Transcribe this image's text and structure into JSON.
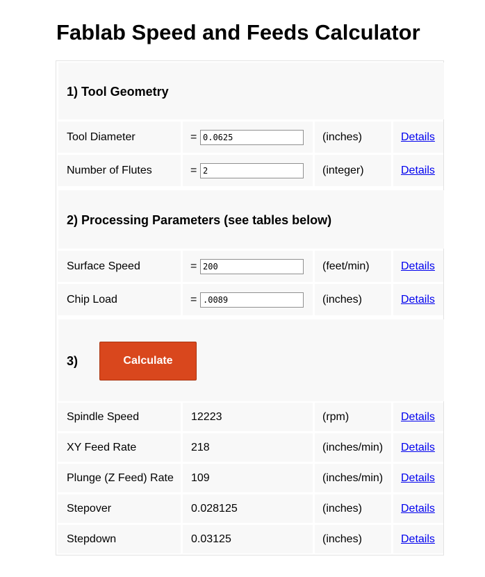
{
  "page": {
    "title": "Fablab Speed and Feeds Calculator"
  },
  "sections": {
    "tool_geometry": "1) Tool Geometry",
    "processing_parameters": "2) Processing Parameters (see tables below)",
    "step3": "3)"
  },
  "inputs": [
    {
      "label": "Tool Diameter",
      "equals": "=",
      "value": "0.0625",
      "unit": "(inches)",
      "details": "Details"
    },
    {
      "label": "Number of Flutes",
      "equals": "=",
      "value": "2",
      "unit": "(integer)",
      "details": "Details"
    },
    {
      "label": "Surface Speed",
      "equals": "=",
      "value": "200",
      "unit": "(feet/min)",
      "details": "Details"
    },
    {
      "label": "Chip Load",
      "equals": "=",
      "value": ".0089",
      "unit": "(inches)",
      "details": "Details"
    }
  ],
  "calculate_label": "Calculate",
  "results": [
    {
      "label": "Spindle Speed",
      "value": "12223",
      "unit": "(rpm)",
      "details": "Details"
    },
    {
      "label": "XY Feed Rate",
      "value": "218",
      "unit": "(inches/min)",
      "details": "Details"
    },
    {
      "label": "Plunge (Z Feed) Rate",
      "value": "109",
      "unit": "(inches/min)",
      "details": "Details"
    },
    {
      "label": "Stepover",
      "value": "0.028125",
      "unit": "(inches)",
      "details": "Details"
    },
    {
      "label": "Stepdown",
      "value": "0.03125",
      "unit": "(inches)",
      "details": "Details"
    }
  ],
  "colors": {
    "calculate_button": "#d9471d",
    "link": "#0000ee",
    "row_background": "#f8f8f8"
  }
}
